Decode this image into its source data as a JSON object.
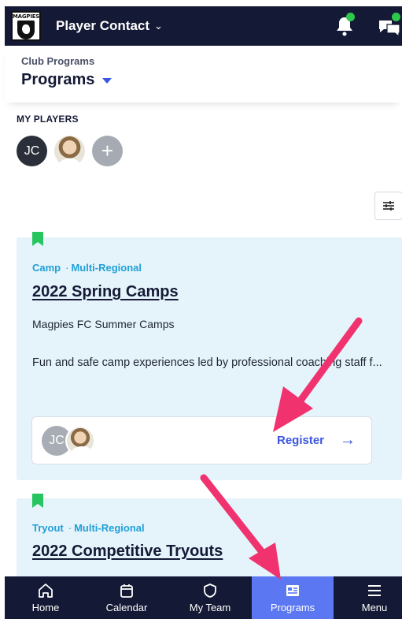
{
  "topbar": {
    "logo_text": "MAGPIES",
    "title": "Player Contact",
    "chevron": "⌄",
    "icons": [
      "bell-icon",
      "chat-icon"
    ],
    "notification_dot_color": "#2ec84a"
  },
  "header": {
    "breadcrumb": "Club Programs",
    "title": "Programs"
  },
  "players": {
    "section_label": "MY PLAYERS",
    "items": [
      {
        "initials": "JC"
      },
      {
        "initials": ""
      },
      {
        "initials": "+"
      }
    ]
  },
  "programs": [
    {
      "type": "Camp",
      "region": "Multi-Regional",
      "title": "2022 Spring Camps",
      "subtitle": "Magpies FC Summer Camps",
      "description": "Fun and safe camp experiences led by professional coaching staff f...",
      "register_label": "Register",
      "register_arrow": "→",
      "avatar_initials": "JC"
    },
    {
      "type": "Tryout",
      "region": "Multi-Regional",
      "title": "2022 Competitive Tryouts"
    }
  ],
  "bottom_nav": [
    {
      "label": "Home",
      "icon": "home-icon"
    },
    {
      "label": "Calendar",
      "icon": "calendar-icon"
    },
    {
      "label": "My Team",
      "icon": "shield-icon"
    },
    {
      "label": "Programs",
      "icon": "programs-icon",
      "active": true
    },
    {
      "label": "Menu",
      "icon": "menu-icon"
    }
  ],
  "colors": {
    "navy": "#141a35",
    "accent_blue": "#3a56e0",
    "active_tab": "#5b78f2",
    "tag_blue": "#1fa0d8",
    "bookmark_green": "#27c55f",
    "card_bg": "#e5f3fb",
    "annotation_pink": "#f0336e"
  }
}
